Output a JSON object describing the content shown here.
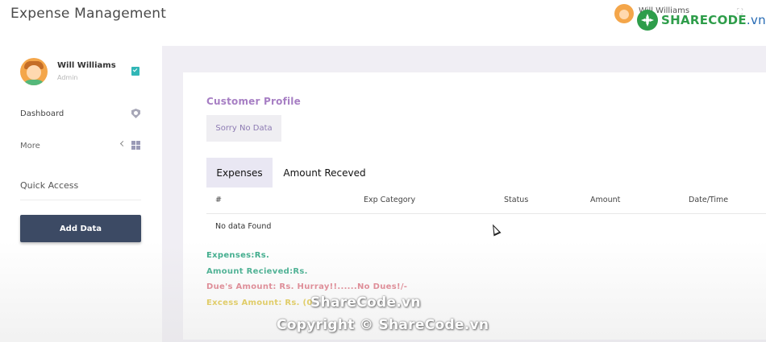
{
  "app": {
    "title": "Expense Management"
  },
  "header": {
    "user_name": "Will Williams"
  },
  "logo": {
    "text_main": "SHARECODE",
    "text_suffix": ".vn"
  },
  "sidebar": {
    "user_name": "Will Williams",
    "user_role": "Admin",
    "nav": [
      {
        "label": "Dashboard",
        "icon": "shield-icon"
      },
      {
        "label": "More",
        "icon": "grid-icon"
      }
    ],
    "quick_access_label": "Quick Access",
    "add_button_label": "Add Data"
  },
  "main": {
    "customer_profile_title": "Customer Profile",
    "no_data_text": "Sorry No Data",
    "tabs": [
      {
        "label": "Expenses",
        "active": true
      },
      {
        "label": "Amount Receved",
        "active": false
      }
    ],
    "table": {
      "columns": [
        "#",
        "Exp Category",
        "Status",
        "Amount",
        "Date/Time"
      ],
      "empty_text": "No data Found"
    },
    "summary": {
      "expenses": "Expenses:Rs.",
      "amount_received": "Amount Recieved:Rs.",
      "due_amount": "Due's Amount: Rs. Hurray!!......No Dues!/-",
      "excess_amount": "Excess Amount: Rs. (0"
    }
  },
  "watermark": {
    "line1": "ShareCode.vn",
    "line2": "Copyright © ShareCode.vn"
  },
  "colors": {
    "accent_purple": "#a77fc4",
    "sum_green": "#3bab8a",
    "sum_red": "#de7a87",
    "sum_yellow": "#e0c53c",
    "button_dark": "#3c4a64"
  }
}
